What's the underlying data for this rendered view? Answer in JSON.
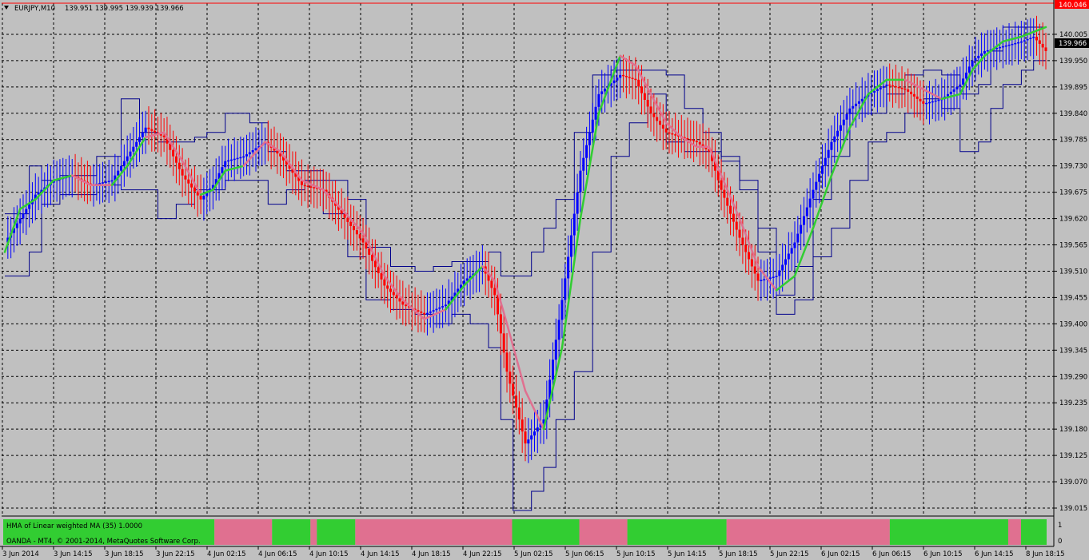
{
  "header": {
    "symbol_label": "EURJPY,M10",
    "ohlc_label": "139.951 139.995 139.939 139.966"
  },
  "indicator": {
    "label": "HMA of Linear weighted MA (35) 1.0000",
    "axis_top": "1",
    "axis_bottom": "0"
  },
  "footer": {
    "copyright": "OANDA - MT4, © 2001-2014, MetaQuotes Software Corp."
  },
  "colors": {
    "background": "#c0c0c0",
    "grid": "#000000",
    "bull_bar": "#0000ff",
    "bear_bar": "#ff0000",
    "hma_up": "#32cd32",
    "hma_down": "#e07090",
    "channel": "#00008b",
    "price_line": "#000000",
    "high_line": "#ff0000",
    "indicator_up": "#32cd32",
    "indicator_down": "#e07090"
  },
  "chart_data": {
    "type": "line",
    "symbol": "EURJPY",
    "timeframe": "M10",
    "ylim": [
      139.0,
      140.07
    ],
    "grid": true,
    "y_ticks": [
      "140.005",
      "139.950",
      "139.895",
      "139.840",
      "139.785",
      "139.730",
      "139.675",
      "139.620",
      "139.565",
      "139.510",
      "139.455",
      "139.400",
      "139.345",
      "139.290",
      "139.235",
      "139.180",
      "139.125",
      "139.070",
      "139.015"
    ],
    "x_ticks": [
      "3 Jun 2014",
      "3 Jun 14:15",
      "3 Jun 18:15",
      "3 Jun 22:15",
      "4 Jun 02:15",
      "4 Jun 06:15",
      "4 Jun 10:15",
      "4 Jun 14:15",
      "4 Jun 18:15",
      "4 Jun 22:15",
      "5 Jun 02:15",
      "5 Jun 06:15",
      "5 Jun 10:15",
      "5 Jun 14:15",
      "5 Jun 18:15",
      "5 Jun 22:15",
      "6 Jun 02:15",
      "6 Jun 06:15",
      "6 Jun 10:15",
      "6 Jun 14:15",
      "8 Jun 18:15"
    ],
    "current_price": "139.966",
    "high_price": "140.046",
    "hma": {
      "name": "HMA",
      "bar_index": [
        0,
        5,
        10,
        16,
        22,
        28,
        35,
        40,
        46,
        52,
        58,
        64,
        68,
        72,
        78,
        85,
        90,
        97,
        104,
        110,
        117,
        124,
        130,
        137,
        144,
        150,
        156,
        160,
        164,
        170,
        176,
        182,
        188,
        194,
        201,
        206,
        211,
        216,
        221,
        226,
        230,
        234,
        240,
        246,
        252,
        258,
        264,
        270,
        276,
        282,
        288,
        294,
        300,
        306,
        312,
        316,
        320,
        326,
        332,
        336,
        340
      ],
      "values": [
        139.55,
        139.64,
        139.66,
        139.7,
        139.71,
        139.69,
        139.69,
        139.73,
        139.79,
        139.8,
        139.74,
        139.67,
        139.68,
        139.72,
        139.73,
        139.78,
        139.76,
        139.7,
        139.68,
        139.64,
        139.59,
        139.5,
        139.45,
        139.41,
        139.43,
        139.48,
        139.52,
        139.49,
        139.4,
        139.26,
        139.18,
        139.35,
        139.62,
        139.84,
        139.96,
        139.94,
        139.88,
        139.82,
        139.79,
        139.77,
        139.77,
        139.71,
        139.62,
        139.52,
        139.47,
        139.5,
        139.6,
        139.71,
        139.81,
        139.88,
        139.91,
        139.91,
        139.89,
        139.87,
        139.88,
        139.93,
        139.96,
        139.99,
        140.0,
        140.01,
        140.02
      ],
      "direction": [
        "up",
        "up",
        "up",
        "up",
        "down",
        "down",
        "up",
        "up",
        "down",
        "down",
        "down",
        "up",
        "up",
        "up",
        "down",
        "down",
        "down",
        "down",
        "down",
        "down",
        "down",
        "down",
        "down",
        "down",
        "up",
        "up",
        "down",
        "down",
        "down",
        "down",
        "up",
        "up",
        "up",
        "up",
        "down",
        "down",
        "down",
        "down",
        "down",
        "down",
        "down",
        "down",
        "down",
        "down",
        "up",
        "up",
        "up",
        "up",
        "up",
        "up",
        "up",
        "down",
        "down",
        "up",
        "up",
        "up",
        "up",
        "up",
        "up",
        "up",
        "up"
      ]
    },
    "candles": {
      "count": 340,
      "close_anchor_index": [
        0,
        5,
        10,
        16,
        22,
        28,
        35,
        40,
        46,
        52,
        58,
        64,
        68,
        72,
        78,
        85,
        90,
        97,
        104,
        110,
        117,
        124,
        130,
        137,
        144,
        150,
        156,
        160,
        164,
        170,
        176,
        182,
        188,
        194,
        201,
        206,
        211,
        216,
        221,
        226,
        230,
        234,
        240,
        246,
        252,
        258,
        264,
        270,
        276,
        282,
        288,
        294,
        300,
        306,
        312,
        316,
        320,
        326,
        332,
        336,
        340
      ],
      "close_anchor_values": [
        139.57,
        139.62,
        139.67,
        139.7,
        139.71,
        139.69,
        139.7,
        139.75,
        139.81,
        139.79,
        139.71,
        139.66,
        139.69,
        139.74,
        139.75,
        139.78,
        139.75,
        139.69,
        139.68,
        139.63,
        139.57,
        139.48,
        139.44,
        139.42,
        139.44,
        139.49,
        139.52,
        139.46,
        139.3,
        139.15,
        139.2,
        139.45,
        139.72,
        139.88,
        139.92,
        139.91,
        139.84,
        139.8,
        139.79,
        139.78,
        139.76,
        139.68,
        139.58,
        139.49,
        139.5,
        139.57,
        139.68,
        139.78,
        139.85,
        139.88,
        139.9,
        139.89,
        139.86,
        139.87,
        139.9,
        139.95,
        139.97,
        139.98,
        139.99,
        140.0,
        139.97
      ]
    },
    "channel": {
      "name": "price channel",
      "x_index": [
        0,
        8,
        12,
        18,
        24,
        30,
        38,
        44,
        50,
        56,
        62,
        66,
        72,
        80,
        86,
        92,
        98,
        104,
        112,
        118,
        126,
        134,
        140,
        146,
        152,
        158,
        162,
        166,
        172,
        176,
        180,
        186,
        192,
        198,
        204,
        210,
        216,
        222,
        228,
        234,
        240,
        246,
        252,
        258,
        264,
        270,
        276,
        282,
        288,
        294,
        300,
        306,
        312,
        318,
        322,
        326,
        332,
        336,
        340
      ],
      "upper": [
        139.63,
        139.73,
        139.7,
        139.71,
        139.71,
        139.75,
        139.87,
        139.8,
        139.78,
        139.78,
        139.79,
        139.8,
        139.84,
        139.82,
        139.76,
        139.72,
        139.72,
        139.7,
        139.66,
        139.56,
        139.52,
        139.51,
        139.52,
        139.53,
        139.53,
        139.55,
        139.5,
        139.5,
        139.55,
        139.6,
        139.66,
        139.8,
        139.92,
        139.93,
        139.93,
        139.93,
        139.92,
        139.85,
        139.8,
        139.75,
        139.7,
        139.55,
        139.46,
        139.52,
        139.66,
        139.75,
        139.84,
        139.84,
        139.88,
        139.92,
        139.93,
        139.92,
        139.88,
        139.9,
        139.97,
        140.02,
        140.02,
        140.02,
        140.02
      ],
      "lower": [
        139.5,
        139.55,
        139.65,
        139.67,
        139.67,
        139.69,
        139.68,
        139.68,
        139.62,
        139.65,
        139.68,
        139.68,
        139.7,
        139.7,
        139.65,
        139.68,
        139.7,
        139.63,
        139.54,
        139.45,
        139.43,
        139.42,
        139.4,
        139.42,
        139.4,
        139.35,
        139.2,
        139.01,
        139.05,
        139.1,
        139.2,
        139.3,
        139.55,
        139.75,
        139.82,
        139.88,
        139.78,
        139.76,
        139.76,
        139.74,
        139.68,
        139.6,
        139.42,
        139.45,
        139.54,
        139.6,
        139.7,
        139.78,
        139.8,
        139.84,
        139.87,
        139.85,
        139.76,
        139.78,
        139.85,
        139.9,
        139.93,
        139.95,
        139.97
      ]
    }
  },
  "indicator_data": {
    "type": "bar",
    "segments": [
      {
        "from": 0,
        "to": 66,
        "state": "up"
      },
      {
        "from": 66,
        "to": 84,
        "state": "down"
      },
      {
        "from": 84,
        "to": 96,
        "state": "up"
      },
      {
        "from": 96,
        "to": 98,
        "state": "down"
      },
      {
        "from": 98,
        "to": 110,
        "state": "up"
      },
      {
        "from": 110,
        "to": 159,
        "state": "down"
      },
      {
        "from": 159,
        "to": 180,
        "state": "up"
      },
      {
        "from": 180,
        "to": 195,
        "state": "down"
      },
      {
        "from": 195,
        "to": 226,
        "state": "up"
      },
      {
        "from": 226,
        "to": 277,
        "state": "down"
      },
      {
        "from": 277,
        "to": 314,
        "state": "up"
      },
      {
        "from": 314,
        "to": 318,
        "state": "down"
      },
      {
        "from": 318,
        "to": 326,
        "state": "up"
      }
    ]
  }
}
